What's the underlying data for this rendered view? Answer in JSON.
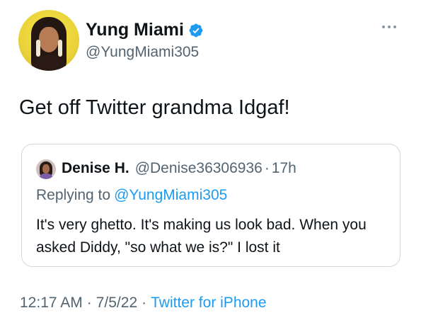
{
  "author": {
    "display_name": "Yung Miami",
    "handle": "@YungMiami305",
    "verified": true
  },
  "tweet": {
    "text": "Get off Twitter grandma Idgaf!"
  },
  "quoted": {
    "display_name": "Denise H.",
    "handle": "@Denise36306936",
    "separator": "·",
    "time": "17h",
    "replying_prefix": "Replying to",
    "replying_handle": "@YungMiami305",
    "text": "It's very ghetto. It's making us look bad. When you asked Diddy, \"so what we is?\" I lost it"
  },
  "meta": {
    "time": "12:17 AM",
    "separator": "·",
    "date": "7/5/22",
    "separator2": "·",
    "source": "Twitter for iPhone"
  },
  "colors": {
    "accent": "#1d9bf0",
    "secondary_text": "#536471",
    "primary_text": "#0f1419",
    "border": "#cfd9de"
  },
  "icons": [
    "verified-badge-icon",
    "more-options-icon"
  ]
}
